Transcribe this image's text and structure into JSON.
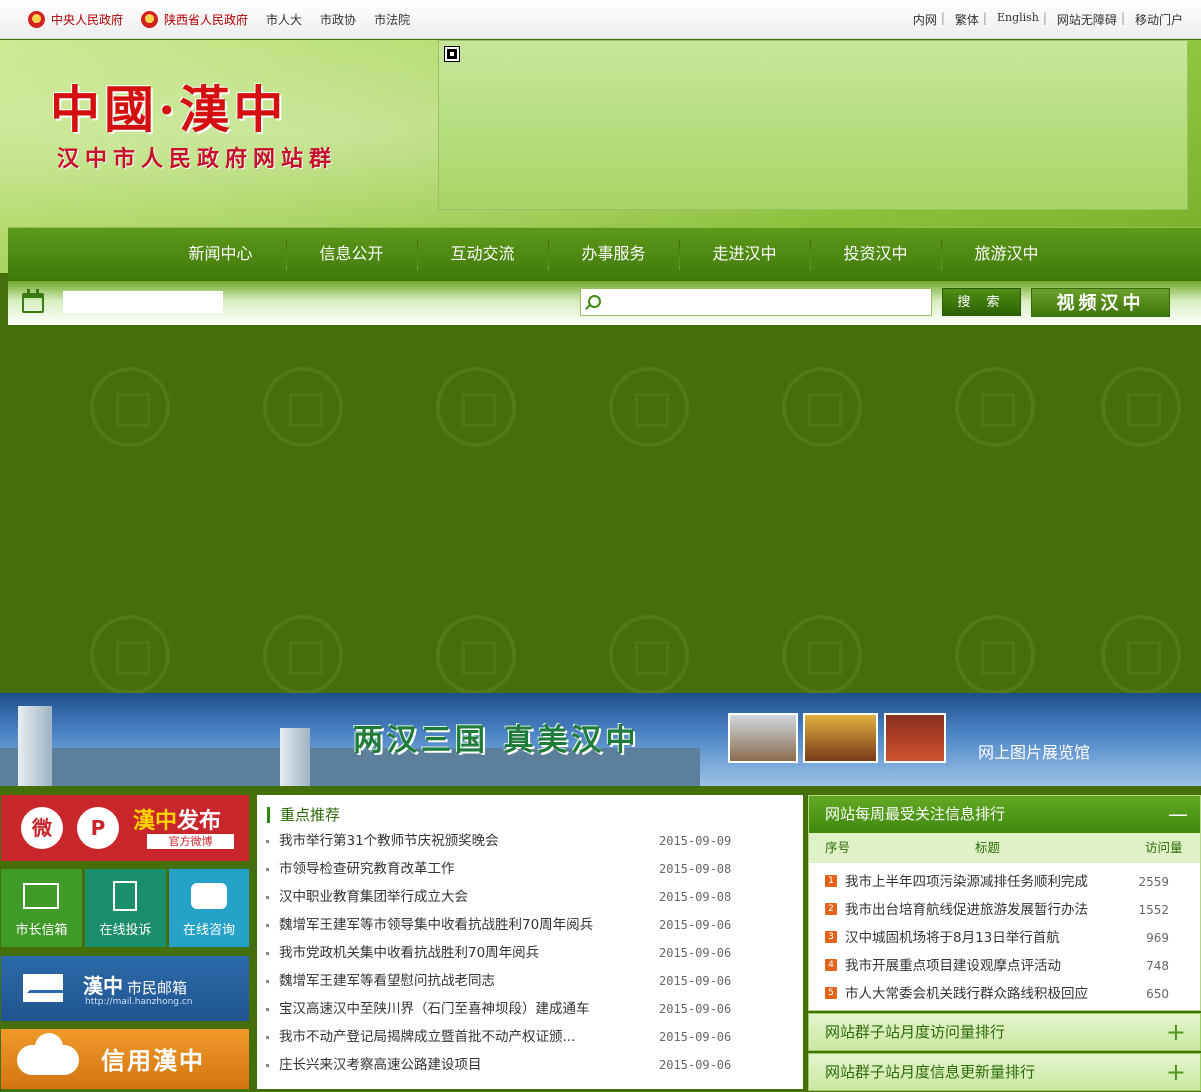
{
  "topbar": {
    "left_links": [
      {
        "label": "中央人民政府",
        "emblem": true
      },
      {
        "label": "陕西省人民政府",
        "emblem": true
      },
      {
        "label": "市人大"
      },
      {
        "label": "市政协"
      },
      {
        "label": "市法院"
      }
    ],
    "right_links": [
      "内网",
      "繁体",
      "English",
      "网站无障碍",
      "移动门户"
    ]
  },
  "header": {
    "logo_title": "中國·漢中",
    "logo_subtitle": "汉中市人民政府网站群"
  },
  "nav": {
    "items": [
      "新闻中心",
      "信息公开",
      "互动交流",
      "办事服务",
      "走进汉中",
      "投资汉中",
      "旅游汉中"
    ]
  },
  "search": {
    "placeholder": "",
    "button_label": "搜 索",
    "video_label": "视频汉中"
  },
  "banner": {
    "slogan": "两汉三国  真美汉中",
    "gallery_label": "网上图片展览馆"
  },
  "left": {
    "weibo": {
      "brand": "漢中",
      "title": "发布",
      "tag": "官方微博"
    },
    "tiles": [
      "市长信箱",
      "在线投诉",
      "在线咨询"
    ],
    "citymail": {
      "brand": "漢中",
      "title": "市民邮箱",
      "url": "http://mail.hanzhong.cn"
    },
    "credit": "信用漢中"
  },
  "featured": {
    "title": "重点推荐",
    "items": [
      {
        "title": "我市举行第31个教师节庆祝颁奖晚会",
        "date": "2015-09-09"
      },
      {
        "title": "市领导检查研究教育改革工作",
        "date": "2015-09-08"
      },
      {
        "title": "汉中职业教育集团举行成立大会",
        "date": "2015-09-08"
      },
      {
        "title": "魏增军王建军等市领导集中收看抗战胜利70周年阅兵",
        "date": "2015-09-06"
      },
      {
        "title": "我市党政机关集中收看抗战胜利70周年阅兵",
        "date": "2015-09-06"
      },
      {
        "title": "魏增军王建军等看望慰问抗战老同志",
        "date": "2015-09-06"
      },
      {
        "title": "宝汉高速汉中至陕川界（石门至喜神坝段）建成通车",
        "date": "2015-09-06"
      },
      {
        "title": "我市不动产登记局揭牌成立暨首批不动产权证颁...",
        "date": "2015-09-06"
      },
      {
        "title": "庄长兴来汉考察高速公路建设项目",
        "date": "2015-09-06"
      }
    ]
  },
  "rank": {
    "title": "网站每周最受关注信息排行",
    "collapse_symbol": "—",
    "col_no": "序号",
    "col_title": "标题",
    "col_views": "访问量",
    "items": [
      {
        "no": "1",
        "title": "我市上半年四项污染源减排任务顺利完成",
        "views": "2559"
      },
      {
        "no": "2",
        "title": "我市出台培育航线促进旅游发展暂行办法",
        "views": "1552"
      },
      {
        "no": "3",
        "title": "汉中城固机场将于8月13日举行首航",
        "views": "969"
      },
      {
        "no": "4",
        "title": "我市开展重点项目建设观摩点评活动",
        "views": "748"
      },
      {
        "no": "5",
        "title": "市人大常委会机关践行群众路线积极回应",
        "views": "650"
      }
    ]
  },
  "panels": [
    {
      "title": "网站群子站月度访问量排行",
      "symbol": "+"
    },
    {
      "title": "网站群子站月度信息更新量排行",
      "symbol": "+"
    }
  ]
}
